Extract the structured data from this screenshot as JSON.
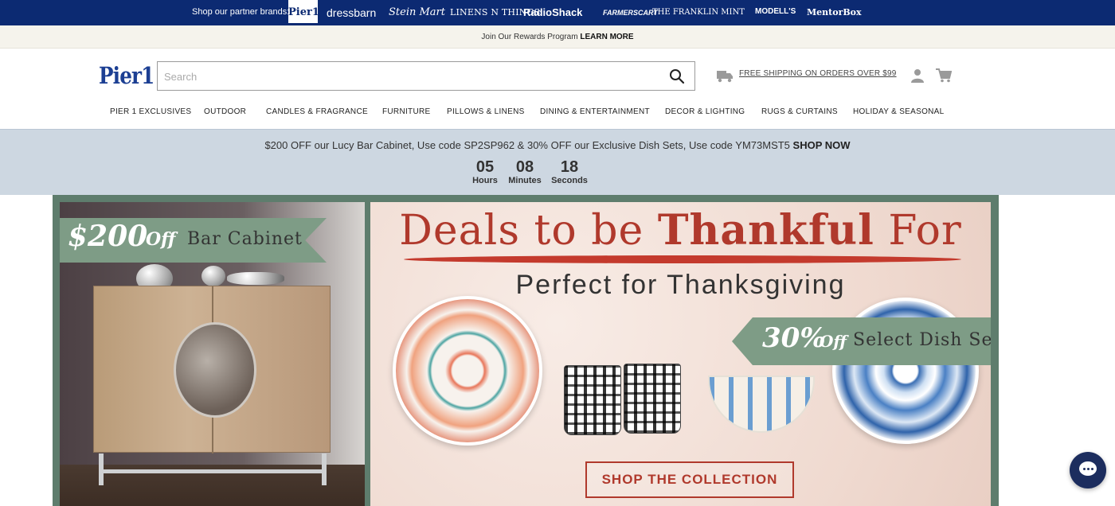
{
  "partner_bar": {
    "label": "Shop our partner brands:",
    "brands": [
      "Pier1",
      "dressbarn",
      "Stein Mart",
      "LINENS N THINGS",
      "RadioShack",
      "FARMERSCART",
      "THE FRANKLIN MINT",
      "MODELL'S",
      "MentorBox"
    ]
  },
  "rewards": {
    "text": "Join Our Rewards Program",
    "link": "LEARN MORE"
  },
  "header": {
    "logo": "Pier1",
    "search_placeholder": "Search",
    "shipping_link": "FREE SHIPPING ON ORDERS OVER $99"
  },
  "nav": [
    "PIER 1 EXCLUSIVES",
    "OUTDOOR",
    "CANDLES & FRAGRANCE",
    "FURNITURE",
    "PILLOWS & LINENS",
    "DINING & ENTERTAINMENT",
    "DECOR & LIGHTING",
    "RUGS & CURTAINS",
    "HOLIDAY & SEASONAL"
  ],
  "promo": {
    "message": "$200 OFF our Lucy Bar Cabinet, Use code SP2SP962 & 30% OFF our Exclusive Dish Sets, Use code YM73MST5",
    "cta": "SHOP NOW",
    "countdown": {
      "hours": "05",
      "hours_label": "Hours",
      "minutes": "08",
      "minutes_label": "Minutes",
      "seconds": "18",
      "seconds_label": "Seconds"
    }
  },
  "hero": {
    "left_amount": "$200",
    "left_off": "Off",
    "left_product": "Bar Cabinet",
    "headline_1": "Deals to be",
    "headline_2": "Thankful",
    "headline_3": "For",
    "subhead": "Perfect for Thanksgiving",
    "right_amount": "30%",
    "right_off": "Off",
    "right_product": "Select Dish Sets",
    "cta": "SHOP THE COLLECTION"
  },
  "colors": {
    "navy": "#0c2a72",
    "promo_bg": "#cdd7e1",
    "hero_red": "#b0392c",
    "ribbon_green": "#7e9c86"
  }
}
